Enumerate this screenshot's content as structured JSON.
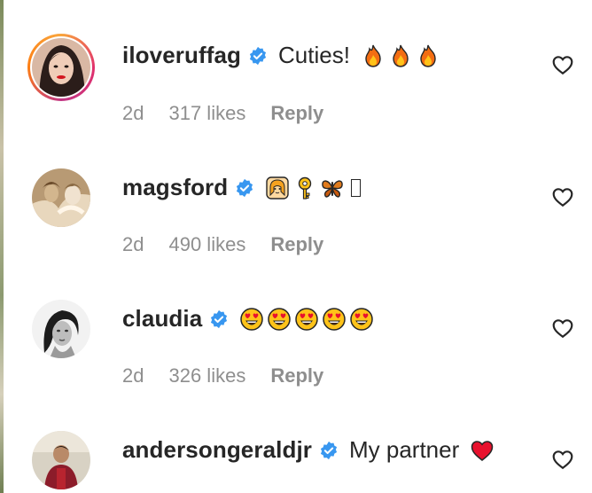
{
  "comments": [
    {
      "username": "iloveruffag",
      "verified": true,
      "text": "Cuties!",
      "emojis": [
        "fire-emoji",
        "fire-emoji",
        "fire-emoji"
      ],
      "time": "2d",
      "likes": "317 likes",
      "reply": "Reply",
      "avatar_ring": true
    },
    {
      "username": "magsford",
      "verified": true,
      "text": "",
      "emojis": [
        "woman-emoji",
        "key-emoji",
        "butterfly-emoji",
        "missing-glyph"
      ],
      "time": "2d",
      "likes": "490 likes",
      "reply": "Reply",
      "avatar_ring": false
    },
    {
      "username": "claudia",
      "verified": true,
      "text": "",
      "emojis": [
        "heart-eyes-emoji",
        "heart-eyes-emoji",
        "heart-eyes-emoji",
        "heart-eyes-emoji",
        "heart-eyes-emoji"
      ],
      "time": "2d",
      "likes": "326 likes",
      "reply": "Reply",
      "avatar_ring": false
    },
    {
      "username": "andersongeraldjr",
      "verified": true,
      "text": "My partner",
      "emojis": [
        "red-heart-emoji"
      ],
      "time": "",
      "likes": "",
      "reply": "",
      "avatar_ring": false
    }
  ],
  "colors": {
    "verified_blue": "#3897f0",
    "secondary_text": "#8e8e8e",
    "primary_text": "#262626"
  }
}
